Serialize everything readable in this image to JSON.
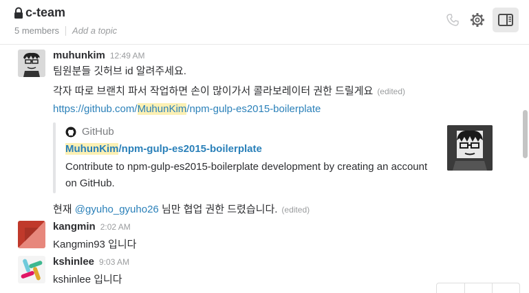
{
  "header": {
    "channel": "c-team",
    "members": "5 members",
    "topic_placeholder": "Add a topic"
  },
  "messages": [
    {
      "author": "muhunkim",
      "time": "12:49 AM",
      "lines": [
        "팀원분들 깃허브 id 알려주세요.",
        "각자 따로 브랜치 파서 작업하면 손이 많이가서 콜라보레이터 권한 드릴게요"
      ],
      "edited": "(edited)",
      "link": {
        "prefix": "https://github.com/",
        "highlight": "MuhunKim",
        "suffix": "/npm-gulp-es2015-boilerplate"
      },
      "attachment": {
        "source": "GitHub",
        "title_highlight": "MuhunKim",
        "title_rest": "/npm-gulp-es2015-boilerplate",
        "description": "Contribute to npm-gulp-es2015-boilerplate development by creating an account on GitHub."
      },
      "followup": {
        "prefix": "현재 ",
        "mention": "@gyuho_gyuho26",
        "suffix": " 님만 협업 권한 드렸습니다.",
        "edited": "(edited)"
      }
    },
    {
      "author": "kangmin",
      "time": "2:02 AM",
      "text": "Kangmin93 입니다"
    },
    {
      "author": "kshinlee",
      "time": "9:03 AM",
      "text": "kshinlee 입니다"
    }
  ],
  "colors": {
    "link": "#2a80b9",
    "highlight": "#fcf0b4",
    "text": "#2c2d30",
    "muted": "#9a9c9e"
  },
  "icons": [
    "lock-icon",
    "phone-icon",
    "gear-icon",
    "sidebar-toggle-icon",
    "github-icon"
  ]
}
